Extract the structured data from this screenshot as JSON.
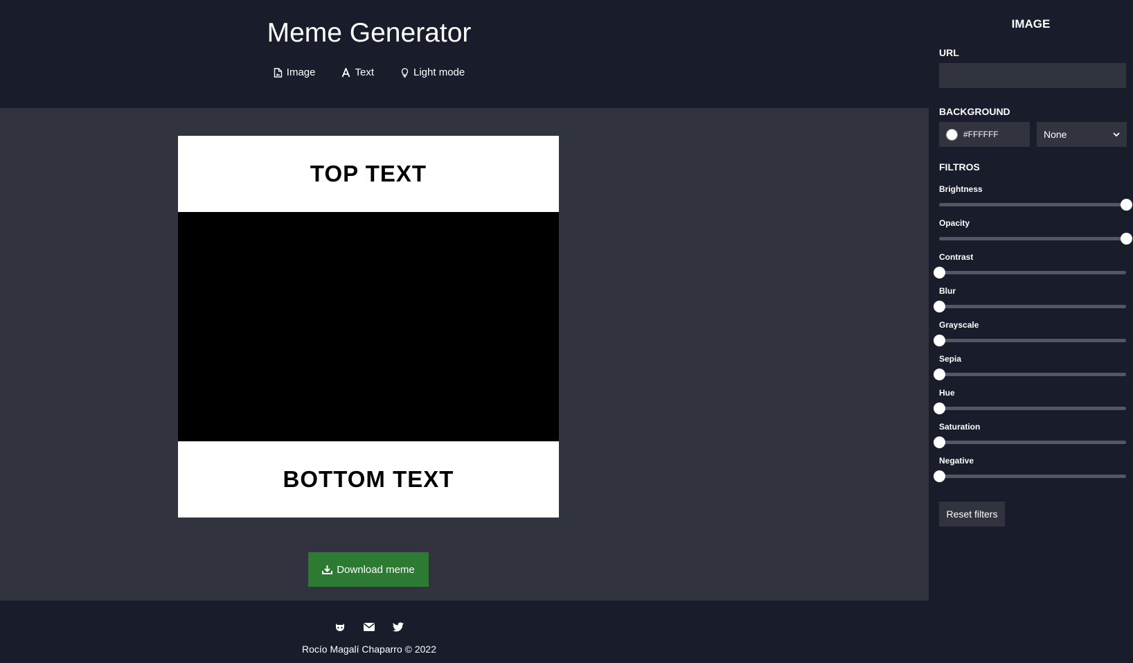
{
  "header": {
    "title": "Meme Generator",
    "nav": [
      {
        "label": "Image",
        "icon": "image-file-icon"
      },
      {
        "label": "Text",
        "icon": "text-icon"
      },
      {
        "label": "Light mode",
        "icon": "lightbulb-icon"
      }
    ]
  },
  "meme": {
    "top_text": "TOP TEXT",
    "bottom_text": "BOTTOM TEXT"
  },
  "download": {
    "label": "Download meme",
    "icon": "download-icon"
  },
  "footer": {
    "icons": [
      "github-icon",
      "email-icon",
      "twitter-icon"
    ],
    "credit": "Rocío Magalí Chaparro © 2022"
  },
  "panel": {
    "title": "IMAGE",
    "url_label": "URL",
    "url_value": "",
    "background_label": "BACKGROUND",
    "background_color": "#FFFFFF",
    "blend_mode": "None",
    "filters_label": "FILTROS",
    "filters": [
      {
        "label": "Brightness",
        "level": 1.0
      },
      {
        "label": "Opacity",
        "level": 1.0
      },
      {
        "label": "Contrast",
        "level": 0.0
      },
      {
        "label": "Blur",
        "level": 0.0
      },
      {
        "label": "Grayscale",
        "level": 0.0
      },
      {
        "label": "Sepia",
        "level": 0.0
      },
      {
        "label": "Hue",
        "level": 0.0
      },
      {
        "label": "Saturation",
        "level": 0.0
      },
      {
        "label": "Negative",
        "level": 0.0
      }
    ],
    "reset_label": "Reset filters"
  },
  "colors": {
    "header_bg": "#191d2b",
    "main_bg": "#31343f",
    "download_bg": "#2d7b32"
  }
}
